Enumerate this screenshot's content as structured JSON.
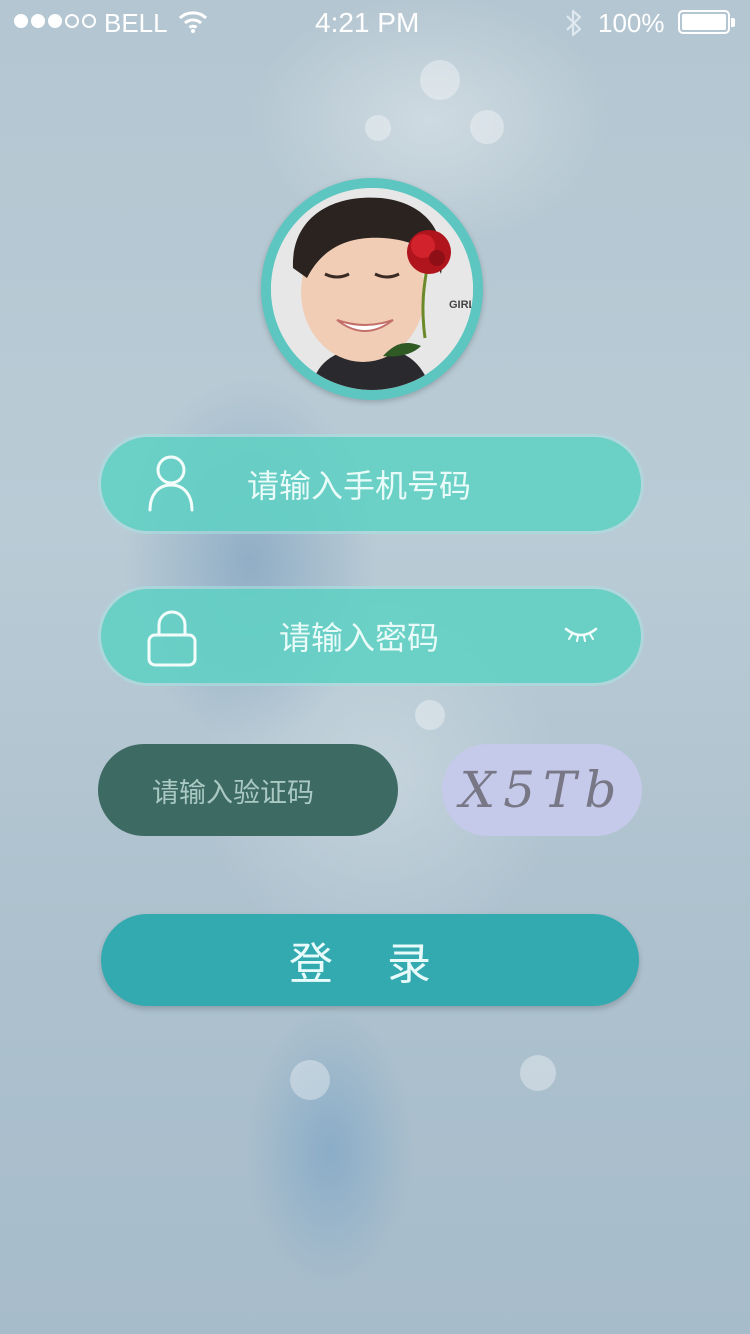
{
  "status_bar": {
    "carrier": "BELL",
    "time": "4:21 PM",
    "battery_percent": "100%",
    "signal_bars_filled": 3,
    "signal_bars_total": 5
  },
  "profile": {
    "avatar_icon": "avatar-photo",
    "ring_color": "#5dc6c0"
  },
  "form": {
    "phone_placeholder": "请输入手机号码",
    "password_placeholder": "请输入密码",
    "captcha_placeholder": "请输入验证码",
    "captcha_code": "X5Tb",
    "login_label": "登 录",
    "field_color": "#60d0c4",
    "captcha_field_color": "#3e6a64",
    "captcha_image_color": "#c5c9ea",
    "login_button_color": "#33aab0",
    "icons": {
      "phone": "user-icon",
      "password": "lock-icon",
      "visibility": "eye-closed-icon"
    }
  }
}
